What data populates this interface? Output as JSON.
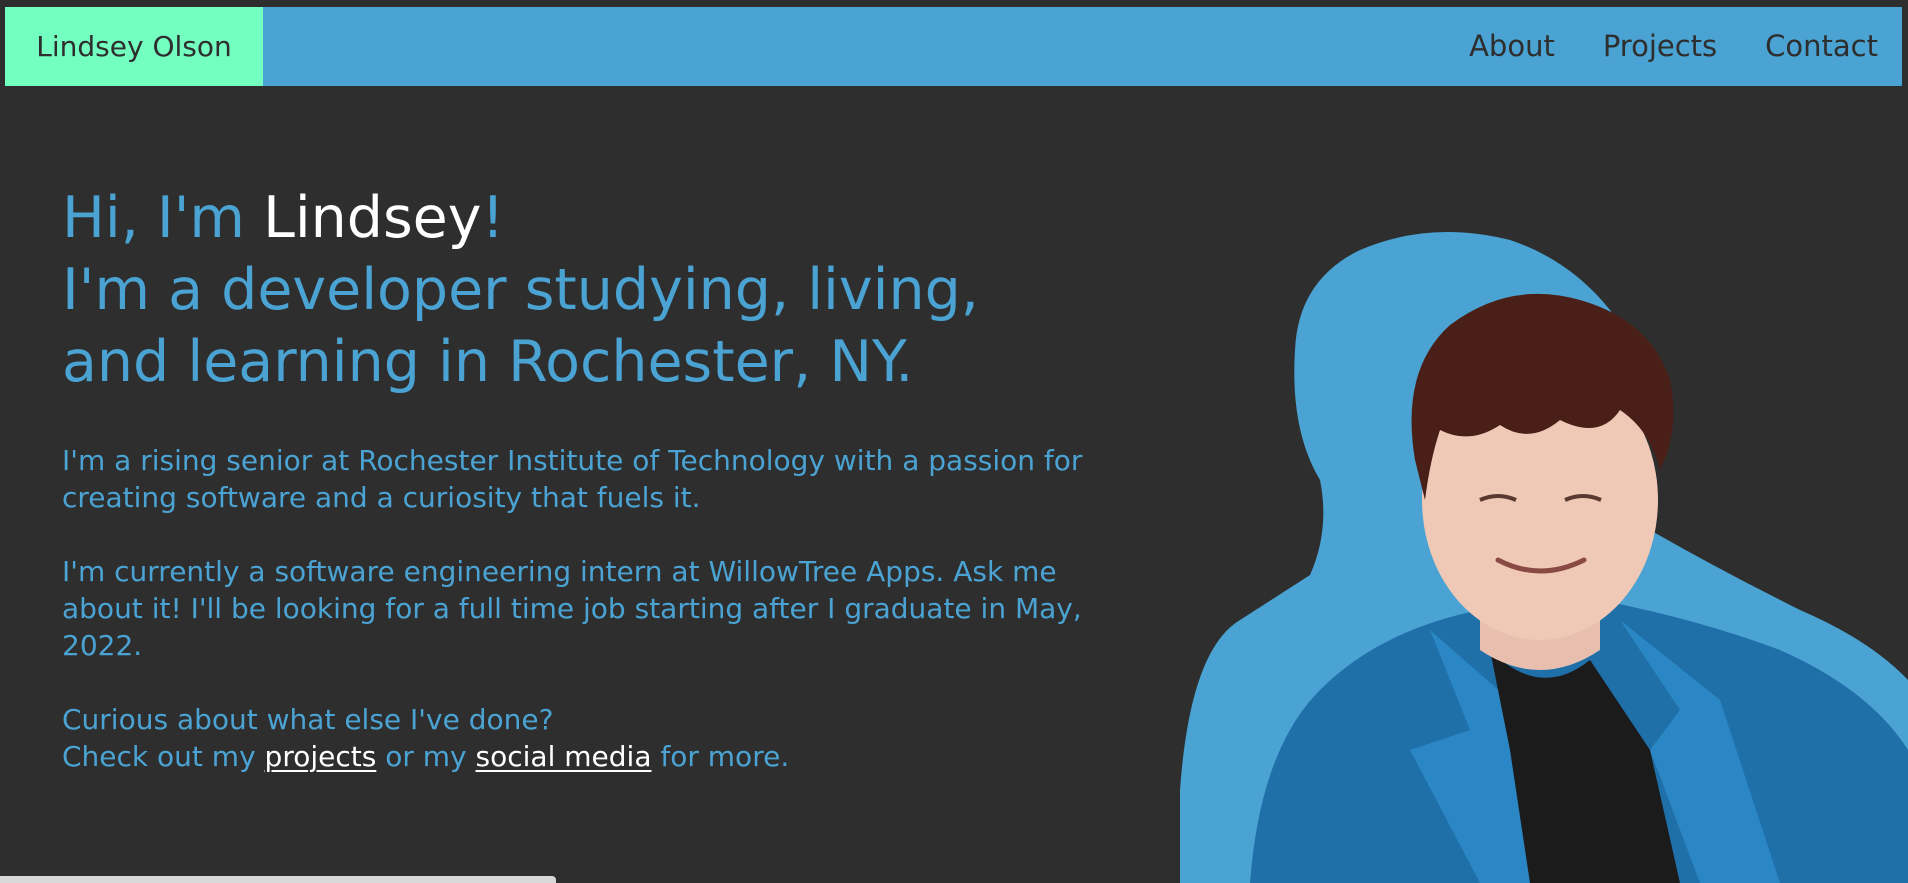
{
  "nav": {
    "brand": "Lindsey Olson",
    "links": [
      "About",
      "Projects",
      "Contact"
    ]
  },
  "hero": {
    "greeting_prefix": "Hi, I'm ",
    "greeting_name": "Lindsey",
    "greeting_suffix": "!",
    "headline_line1": "I'm a developer studying, living,",
    "headline_line2": "and learning in Rochester, NY."
  },
  "about": {
    "paragraph1": "I'm a rising senior at Rochester Institute of Technology with a passion for creating software and a curiosity that fuels it.",
    "paragraph2": "I'm currently a software engineering intern at WillowTree Apps. Ask me about it! I'll be looking for a full time job starting after I graduate in May, 2022.",
    "curious_line": "Curious about what else I've done?",
    "check_prefix": "Check out my ",
    "projects_link": "projects",
    "check_middle": " or my ",
    "social_link": "social media",
    "check_suffix": " for more."
  },
  "colors": {
    "background": "#2e2e2e",
    "accent_blue": "#4aa3d3",
    "brand_green": "#72ffc0",
    "highlight_white": "#ffffff"
  }
}
